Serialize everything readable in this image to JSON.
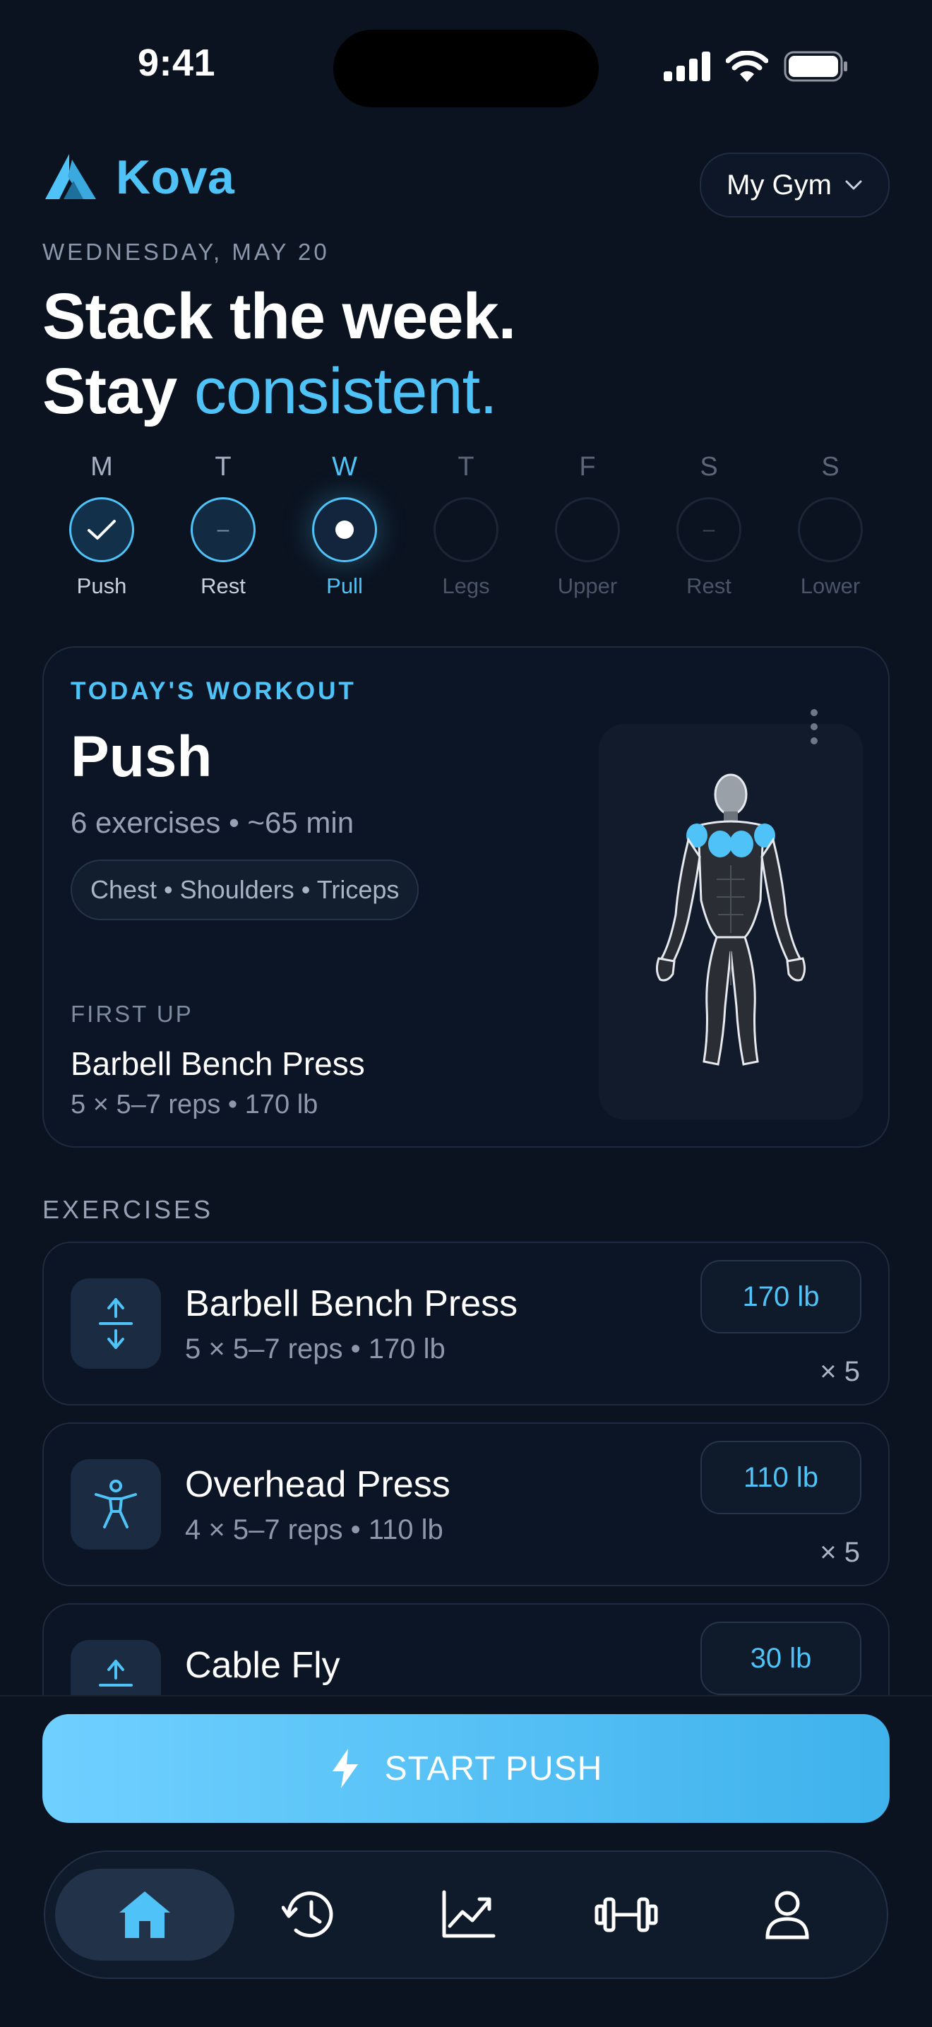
{
  "status_bar": {
    "time": "9:41"
  },
  "header": {
    "app_name": "Kova",
    "gym_selector": "My Gym"
  },
  "date": "WEDNESDAY, MAY 20",
  "headline": {
    "line1": "Stack the week.",
    "line2_plain": "Stay",
    "line2_accent": "consistent."
  },
  "week": [
    {
      "letter": "M",
      "label": "Push",
      "state": "done"
    },
    {
      "letter": "T",
      "label": "Rest",
      "state": "rest-past",
      "mark": "–"
    },
    {
      "letter": "W",
      "label": "Pull",
      "state": "today"
    },
    {
      "letter": "T",
      "label": "Legs",
      "state": "future"
    },
    {
      "letter": "F",
      "label": "Upper",
      "state": "future"
    },
    {
      "letter": "S",
      "label": "Rest",
      "state": "future-rest",
      "mark": "–"
    },
    {
      "letter": "S",
      "label": "Lower",
      "state": "future"
    }
  ],
  "today_workout": {
    "label": "TODAY'S WORKOUT",
    "title": "Push",
    "meta": "6 exercises • ~65 min",
    "muscles": "Chest • Shoulders • Triceps",
    "first_up_label": "FIRST UP",
    "first_exercise": "Barbell Bench Press",
    "first_detail": "5 × 5–7 reps • 170 lb",
    "highlight_color": "#4fc3f7"
  },
  "exercises_heading": "EXERCISES",
  "exercises": [
    {
      "name": "Barbell Bench Press",
      "detail": "5 × 5–7 reps • 170 lb",
      "weight": "170 lb",
      "reps": "× 5",
      "icon": "compress-arrows-icon"
    },
    {
      "name": "Overhead Press",
      "detail": "4 × 5–7 reps • 110 lb",
      "weight": "110 lb",
      "reps": "× 5",
      "icon": "person-arms-up-icon"
    },
    {
      "name": "Cable Fly",
      "detail": "",
      "weight": "30 lb",
      "reps": "",
      "icon": "arrow-up-icon"
    }
  ],
  "start_button": "START PUSH",
  "tabs": [
    {
      "name": "home",
      "icon": "home-icon",
      "active": true
    },
    {
      "name": "history",
      "icon": "history-icon",
      "active": false
    },
    {
      "name": "progress",
      "icon": "chart-trend-icon",
      "active": false
    },
    {
      "name": "workouts",
      "icon": "dumbbell-icon",
      "active": false
    },
    {
      "name": "profile",
      "icon": "profile-icon",
      "active": false
    }
  ],
  "colors": {
    "accent": "#4fc3f7",
    "background": "#0b1320",
    "card": "#0c1525"
  }
}
